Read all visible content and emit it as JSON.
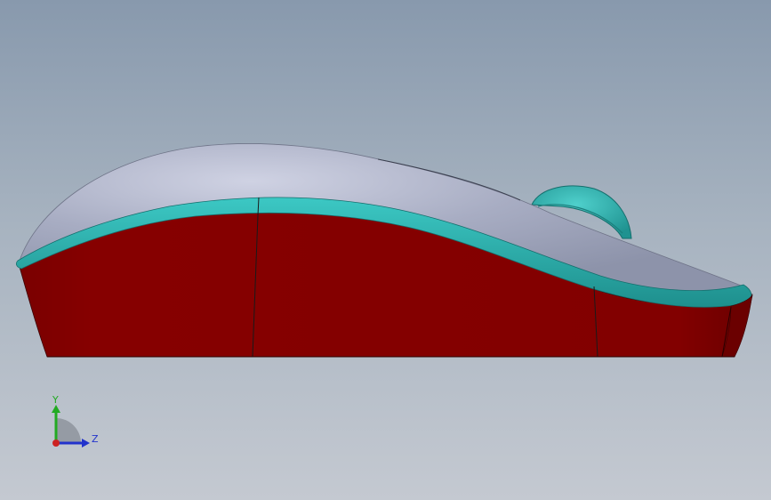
{
  "view": {
    "background_top": "#8899ad",
    "background_bottom": "#c4c9d1"
  },
  "model": {
    "shell_color": "#a9b0c4",
    "shell_highlight": "#c9cde0",
    "trim_color": "#28aaa8",
    "base_color": "#800000",
    "wheel_color": "#2aaaa8",
    "edge_color": "#1a1a1a"
  },
  "triad": {
    "y_label": "Y",
    "z_label": "Z",
    "y_color": "#22aa22",
    "z_color": "#2233cc",
    "x_color": "#cc2222",
    "icon": "coordinate-triad-icon"
  }
}
